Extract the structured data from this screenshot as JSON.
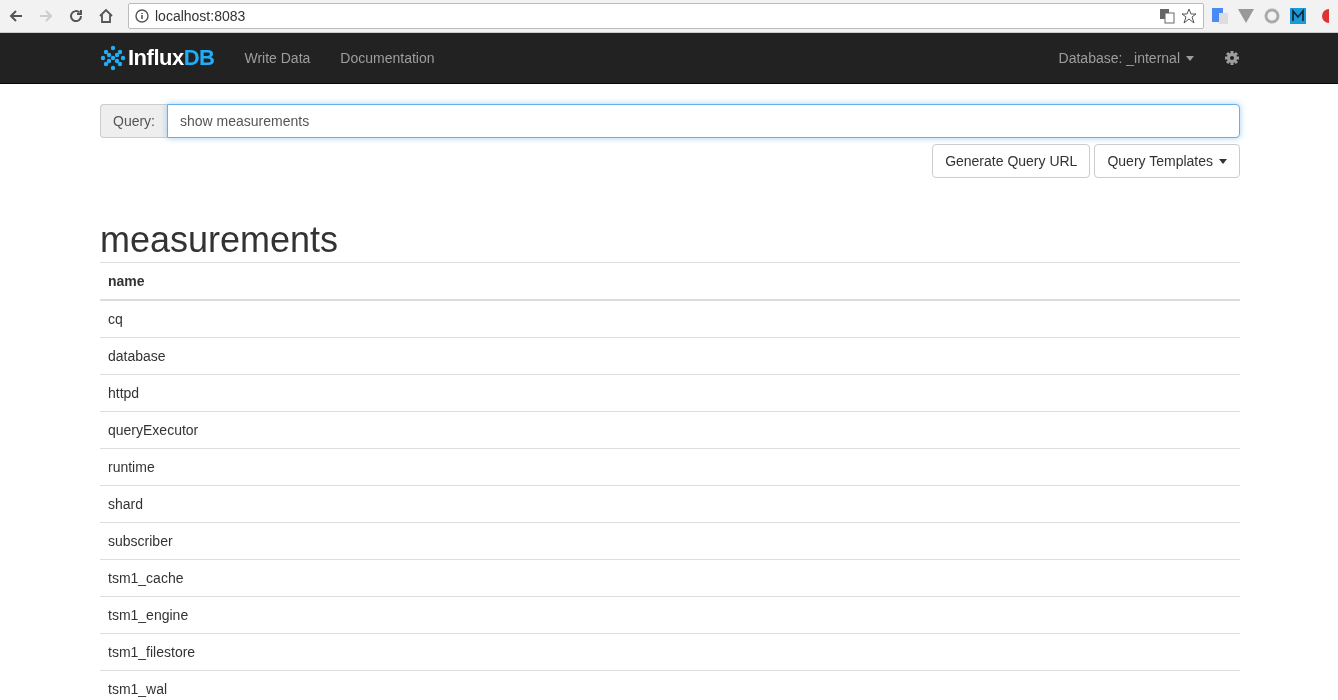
{
  "browser": {
    "url": "localhost:8083"
  },
  "navbar": {
    "logo_parts": [
      "Influx",
      "DB"
    ],
    "links": [
      "Write Data",
      "Documentation"
    ],
    "database_label": "Database: _internal"
  },
  "query": {
    "label": "Query:",
    "value": "show measurements"
  },
  "buttons": [
    "Generate Query URL",
    "Query Templates"
  ],
  "result": {
    "title": "measurements",
    "columns": [
      "name"
    ],
    "rows": [
      "cq",
      "database",
      "httpd",
      "queryExecutor",
      "runtime",
      "shard",
      "subscriber",
      "tsm1_cache",
      "tsm1_engine",
      "tsm1_filestore",
      "tsm1_wal"
    ]
  }
}
